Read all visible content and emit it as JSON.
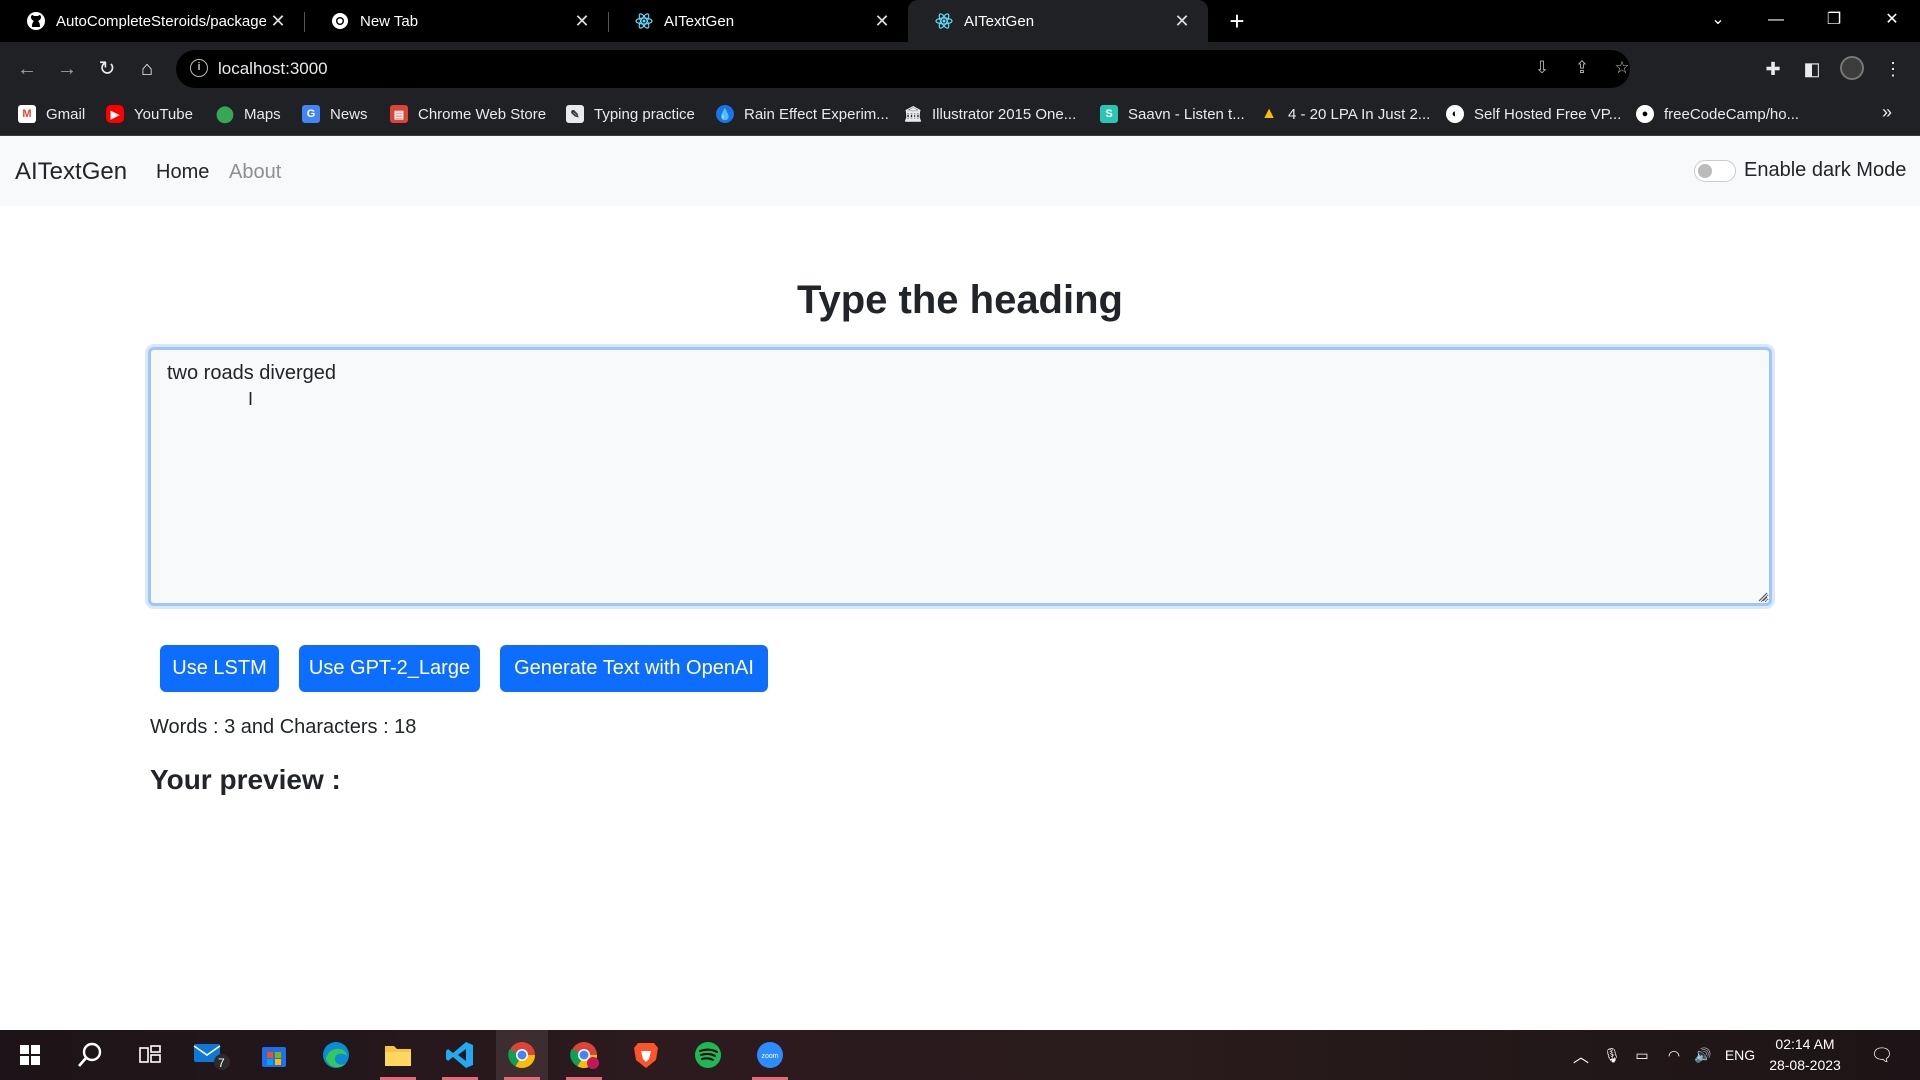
{
  "browser": {
    "tabs": [
      {
        "title": "AutoCompleteSteroids/package.j",
        "icon": "github-icon",
        "active": false
      },
      {
        "title": "New Tab",
        "icon": "chrome-icon",
        "active": false
      },
      {
        "title": "AITextGen",
        "icon": "react-icon",
        "active": false
      },
      {
        "title": "AITextGen",
        "icon": "react-icon",
        "active": true
      }
    ],
    "close_glyph": "✕",
    "new_tab_glyph": "+",
    "url": "localhost:3000",
    "bookmarks": [
      {
        "label": "Gmail",
        "icon": "gmail-icon",
        "color": "#ea4335"
      },
      {
        "label": "YouTube",
        "icon": "youtube-icon",
        "color": "#ff0000"
      },
      {
        "label": "Maps",
        "icon": "maps-icon",
        "color": "#34a853"
      },
      {
        "label": "News",
        "icon": "news-icon",
        "color": "#4285f4"
      },
      {
        "label": "Chrome Web Store",
        "icon": "webstore-icon",
        "color": "#db4437"
      },
      {
        "label": "Typing practice",
        "icon": "typing-icon",
        "color": "#777777"
      },
      {
        "label": "Rain Effect Experim...",
        "icon": "rain-icon",
        "color": "#1a73e8"
      },
      {
        "label": "Illustrator 2015 One...",
        "icon": "illustrator-icon",
        "color": "#555555"
      },
      {
        "label": "Saavn - Listen t...",
        "icon": "saavn-icon",
        "color": "#2bc5b4"
      },
      {
        "label": "4 - 20 LPA In Just 2...",
        "icon": "drive-icon",
        "color": "#fbbc04"
      },
      {
        "label": "Self Hosted Free VP...",
        "icon": "vpn-icon",
        "color": "#ffffff"
      },
      {
        "label": "freeCodeCamp/ho...",
        "icon": "github-icon",
        "color": "#ffffff"
      }
    ]
  },
  "app": {
    "brand": "AITextGen",
    "nav": [
      {
        "label": "Home",
        "active": true
      },
      {
        "label": "About",
        "active": false
      }
    ],
    "dark_mode_label": "Enable dark Mode",
    "dark_mode_on": false,
    "heading": "Type the heading",
    "textarea_value": "two roads diverged",
    "buttons": [
      "Use LSTM",
      "Use GPT-2_Large",
      "Generate Text with OpenAI"
    ],
    "counts": "Words : 3 and Characters : 18",
    "preview_heading": "Your preview :",
    "accent_color": "#0d6efd"
  },
  "taskbar": {
    "clock_time": "02:14 AM",
    "clock_date": "28-08-2023",
    "language": "ENG",
    "mail_badge": "7"
  }
}
